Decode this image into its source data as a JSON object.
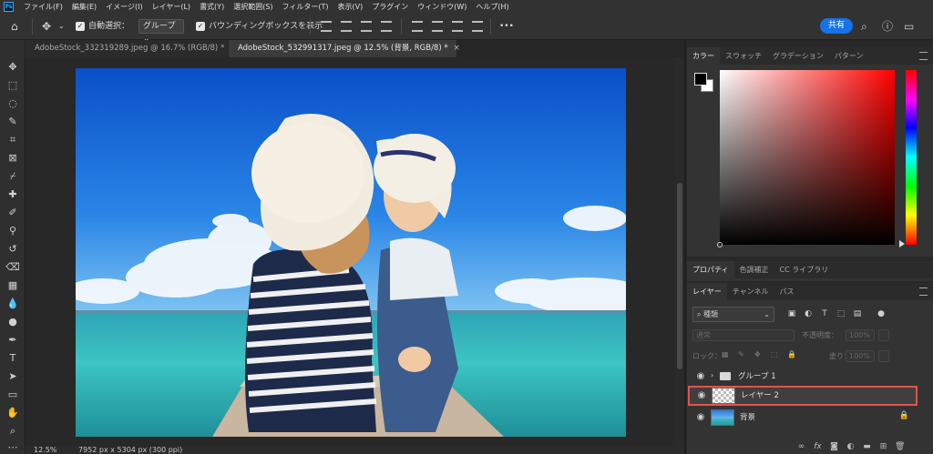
{
  "app": {
    "logo": "Ps"
  },
  "menu": [
    "ファイル(F)",
    "編集(E)",
    "イメージ(I)",
    "レイヤー(L)",
    "書式(Y)",
    "選択範囲(S)",
    "フィルター(T)",
    "表示(V)",
    "プラグイン",
    "ウィンドウ(W)",
    "ヘルプ(H)"
  ],
  "options": {
    "auto_select_label": "自動選択：",
    "auto_select_value": "グループ",
    "bounding_box_label": "バウンディングボックスを表示",
    "more": "•••",
    "share_label": "共有"
  },
  "tabs": [
    {
      "label": "AdobeStock_332319289.jpeg @ 16.7% (RGB/8) *",
      "close": "×"
    },
    {
      "label": "AdobeStock_532991317.jpeg @ 12.5% (背景, RGB/8) *",
      "close": "×"
    }
  ],
  "status": {
    "zoom": "12.5%",
    "doc_info": "7952 px x 5304 px (300 ppi)"
  },
  "color_panel": {
    "tabs": [
      "カラー",
      "スウォッチ",
      "グラデーション",
      "パターン"
    ],
    "foreground": "#000000",
    "background": "#ffffff"
  },
  "properties_panel": {
    "tabs": [
      "プロパティ",
      "色調補正",
      "CC ライブラリ"
    ]
  },
  "layers_panel": {
    "tabs": [
      "レイヤー",
      "チャンネル",
      "パス"
    ],
    "filter_kind": "種類",
    "blend_mode": "通常",
    "opacity_label": "不透明度：",
    "opacity_value": "100%",
    "lock_label": "ロック：",
    "fill_label": "塗り：",
    "fill_value": "100%",
    "layers": [
      {
        "name": "グループ 1",
        "type": "group"
      },
      {
        "name": "レイヤー 2",
        "type": "pixel",
        "selected": true
      },
      {
        "name": "背景",
        "type": "background",
        "locked": true
      }
    ]
  },
  "colors": {
    "accent": "#1473e6",
    "selection_outline": "#e0544c"
  }
}
